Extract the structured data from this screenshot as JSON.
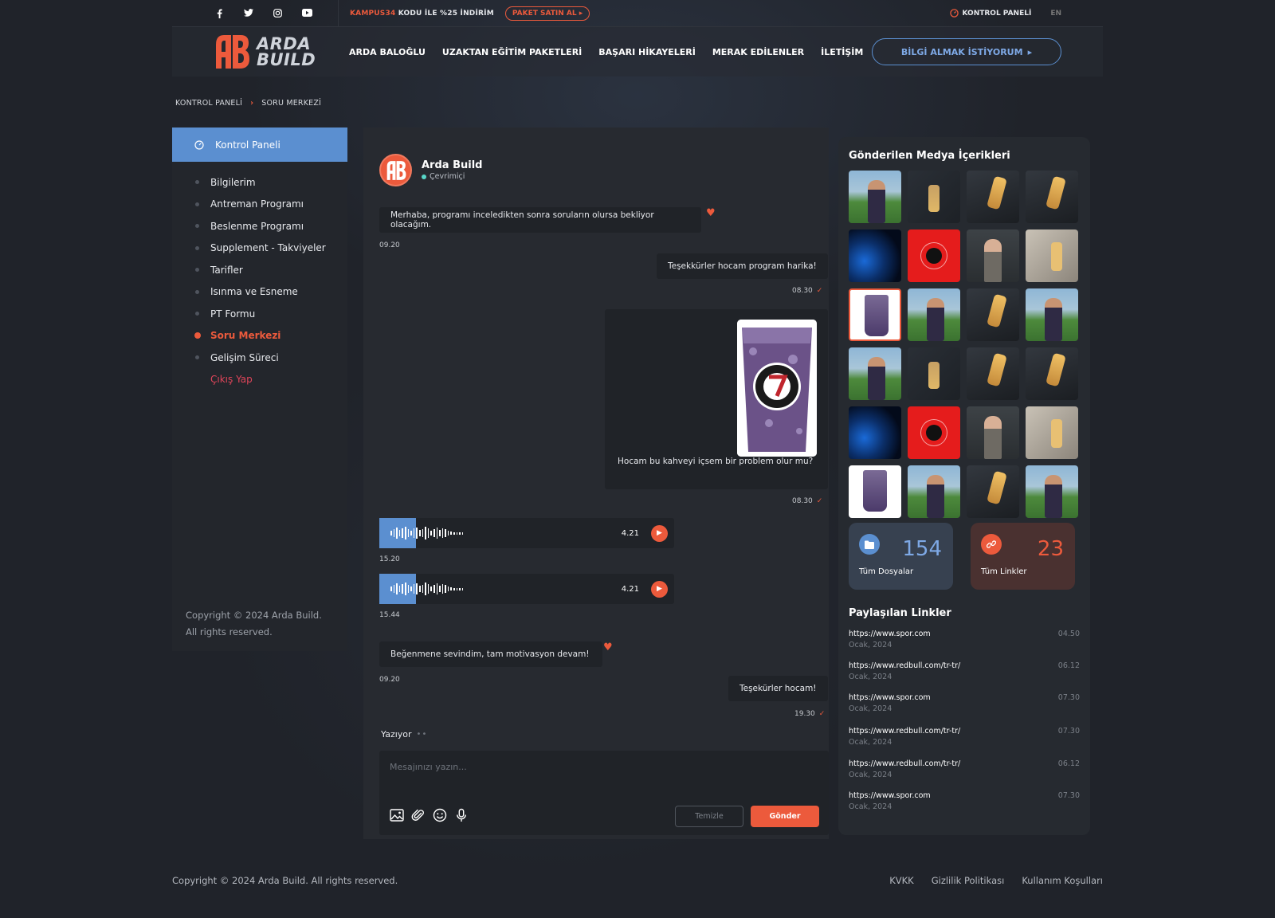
{
  "topbar": {
    "promo_code": "KAMPUS34",
    "promo_text": "KODU İLE %25 İNDİRİM",
    "package_button": "PAKET SATIN AL",
    "control_panel": "KONTROL PANELİ",
    "language": "EN"
  },
  "header": {
    "logo_line1": "ARDA",
    "logo_line2": "BUILD",
    "nav": [
      "ARDA BALOĞLU",
      "UZAKTAN EĞİTİM PAKETLERİ",
      "BAŞARI HİKAYELERİ",
      "MERAK EDİLENLER",
      "İLETİŞİM"
    ],
    "info_button": "BİLGİ ALMAK İSTİYORUM"
  },
  "breadcrumb": {
    "root": "KONTROL PANELİ",
    "current": "SORU MERKEZİ"
  },
  "sidebar": {
    "active_label": "Kontrol Paneli",
    "items": [
      "Bilgilerim",
      "Antreman Programı",
      "Beslenme Programı",
      "Supplement - Takviyeler",
      "Tarifler",
      "Isınma ve Esneme",
      "PT Formu",
      "Soru Merkezi",
      "Gelişim Süreci"
    ],
    "logout": "Çıkış Yap",
    "copyright1": "Copyright © 2024 Arda Build.",
    "copyright2": "All rights reserved."
  },
  "chat": {
    "name": "Arda Build",
    "status": "Çevrimiçi",
    "messages": [
      {
        "text": "Merhaba, programı inceledikten sonra soruların olursa bekliyor olacağım.",
        "time": "09.20"
      },
      {
        "text": "Teşekkürler hocam program harika!",
        "time": "08.30"
      },
      {
        "text": "Hocam bu kahveyi içsem bir problem olur mu?",
        "time": "08.30"
      },
      {
        "text": "",
        "time": "15.20",
        "duration": "4.21"
      },
      {
        "text": "",
        "time": "15.44",
        "duration": "4.21"
      },
      {
        "text": "Beğenmene sevindim, tam motivasyon devam!",
        "time": "09.20"
      },
      {
        "text": "Teşekürler hocam!",
        "time": "19.30"
      }
    ],
    "typing": "Yazıyor",
    "placeholder": "Mesajınızı yazın...",
    "clear_button": "Temizle",
    "send_button": "Gönder"
  },
  "media": {
    "title": "Gönderilen Medya İçerikleri",
    "files_count": "154",
    "files_label": "Tüm Dosyalar",
    "links_count": "23",
    "links_label": "Tüm Linkler",
    "links_title": "Paylaşılan Linkler",
    "links": [
      {
        "url": "https://www.spor.com",
        "date": "Ocak, 2024",
        "time": "04.50"
      },
      {
        "url": "https://www.redbull.com/tr-tr/",
        "date": "Ocak, 2024",
        "time": "06.12"
      },
      {
        "url": "https://www.spor.com",
        "date": "Ocak, 2024",
        "time": "07.30"
      },
      {
        "url": "https://www.redbull.com/tr-tr/",
        "date": "Ocak, 2024",
        "time": "07.30"
      },
      {
        "url": "https://www.redbull.com/tr-tr/",
        "date": "Ocak, 2024",
        "time": "06.12"
      },
      {
        "url": "https://www.spor.com",
        "date": "Ocak, 2024",
        "time": "07.30"
      }
    ]
  },
  "footer": {
    "copyright": "Copyright © 2024 Arda Build. All rights reserved.",
    "links": [
      "KVKK",
      "Gizlilik Politikası",
      "Kullanım Koşulları"
    ]
  }
}
